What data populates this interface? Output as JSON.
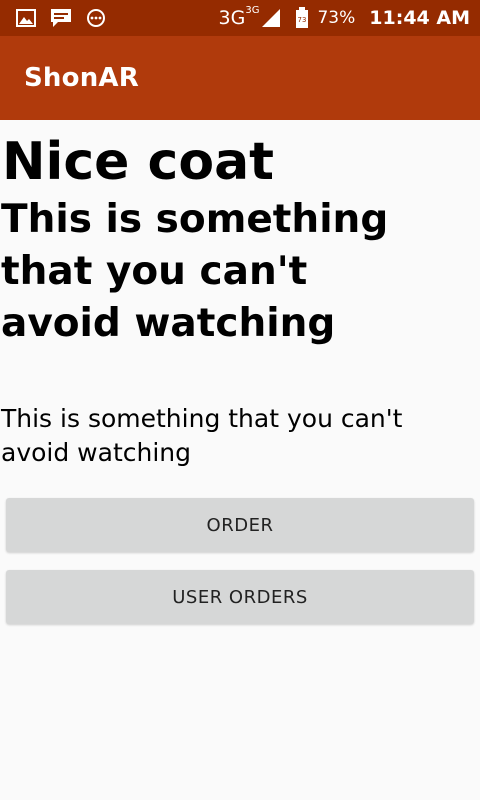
{
  "status_bar": {
    "icons_left": [
      "image-icon",
      "chat-icon",
      "more-circle-icon"
    ],
    "network": "3G",
    "network_sup": "3G",
    "battery_level_label": "73",
    "battery_percent": "73%",
    "time": "11:44 AM"
  },
  "app_bar": {
    "title": "ShonAR"
  },
  "product": {
    "name": "Nice coat",
    "tagline": "This is something that you can't avoid watching",
    "description": "This is something that you can't avoid watching"
  },
  "actions": {
    "order_label": "ORDER",
    "user_orders_label": "USER ORDERS"
  },
  "colors": {
    "status_bar_bg": "#952b00",
    "app_bar_bg": "#b03a0c",
    "button_bg": "#d6d7d7",
    "page_bg": "#fafafa"
  }
}
